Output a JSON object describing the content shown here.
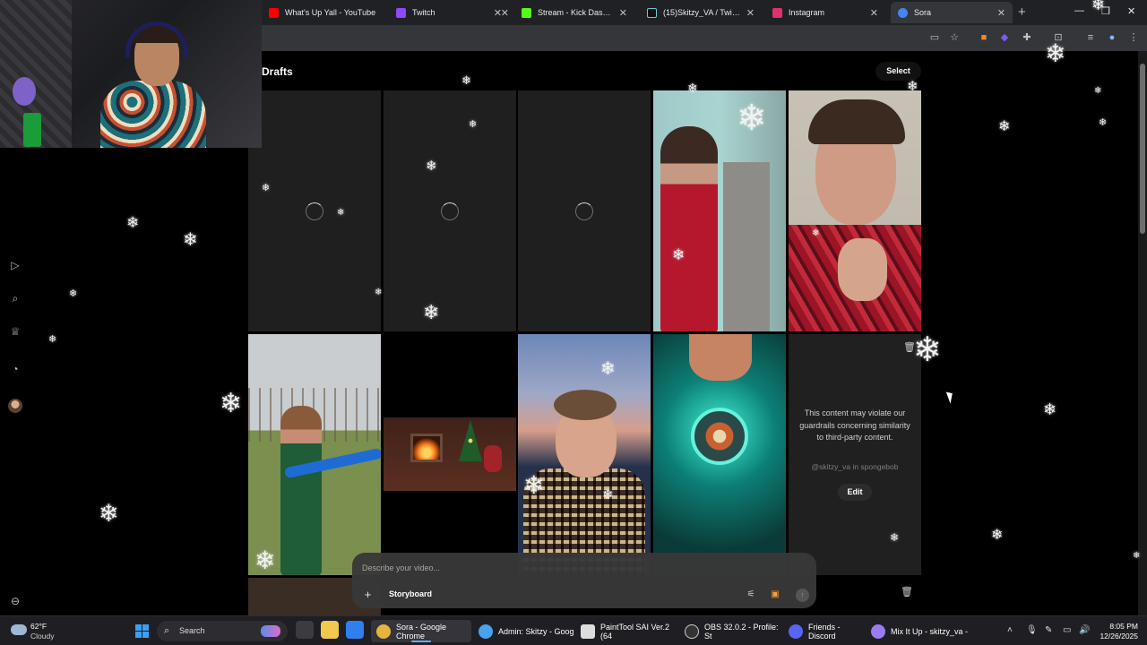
{
  "browser": {
    "tabs": [
      {
        "title": "What's Up Yall - YouTube",
        "favicon_color": "#ff0000"
      },
      {
        "title": "Twitch",
        "favicon_color": "#9146ff"
      },
      {
        "title": "Stream - Kick Dashboard",
        "favicon_color": "#53fc18"
      },
      {
        "title": "(15)Skitzy_VA / Twitch and",
        "favicon_color": "#111111"
      },
      {
        "title": "Instagram",
        "favicon_color": "#e1306c"
      },
      {
        "title": "Sora",
        "favicon_color": "#4285f4"
      }
    ],
    "active_tab": 5
  },
  "page": {
    "title": "Drafts",
    "select_label": "Select"
  },
  "sidebar": {
    "icons": [
      "video-icon",
      "search-icon",
      "trophy-icon",
      "bell-icon",
      "avatar",
      "settings-icon"
    ]
  },
  "grid": {
    "tiles": [
      {
        "kind": "loading"
      },
      {
        "kind": "loading"
      },
      {
        "kind": "loading"
      },
      {
        "kind": "video",
        "scene": "bathroom-stall"
      },
      {
        "kind": "video",
        "scene": "man-pointing"
      },
      {
        "kind": "video",
        "scene": "field-sword"
      },
      {
        "kind": "video",
        "scene": "fireplace-christmas"
      },
      {
        "kind": "video",
        "scene": "man-glasses-sunset"
      },
      {
        "kind": "video",
        "scene": "armored-hero"
      },
      {
        "kind": "blocked"
      }
    ],
    "blocked_message": "This content may violate our guardrails concerning similarity to third-party content.",
    "blocked_prompt": "@skitzy_va in spongebob",
    "edit_label": "Edit"
  },
  "prompt_bar": {
    "placeholder": "Describe your video...",
    "storyboard_label": "Storyboard"
  },
  "taskbar": {
    "weather_temp": "62°F",
    "weather_condition": "Cloudy",
    "search_label": "Search",
    "items": [
      {
        "label": "Sora - Google Chrome",
        "active": true,
        "color": "#e9b33b"
      },
      {
        "label": "Admin: Skitzy - Goog",
        "active": false,
        "color": "#4aa1f0"
      },
      {
        "label": "PaintTool SAI Ver.2 (64",
        "active": false,
        "color": "#dddddd"
      },
      {
        "label": "OBS 32.0.2 - Profile: St",
        "active": false,
        "color": "#333333"
      },
      {
        "label": "Friends - Discord",
        "active": false,
        "color": "#5865f2"
      },
      {
        "label": "Mix It Up - skitzy_va - ",
        "active": false,
        "color": "#9b7cf0"
      }
    ],
    "time": "8:05 PM",
    "date": "12/26/2025"
  }
}
